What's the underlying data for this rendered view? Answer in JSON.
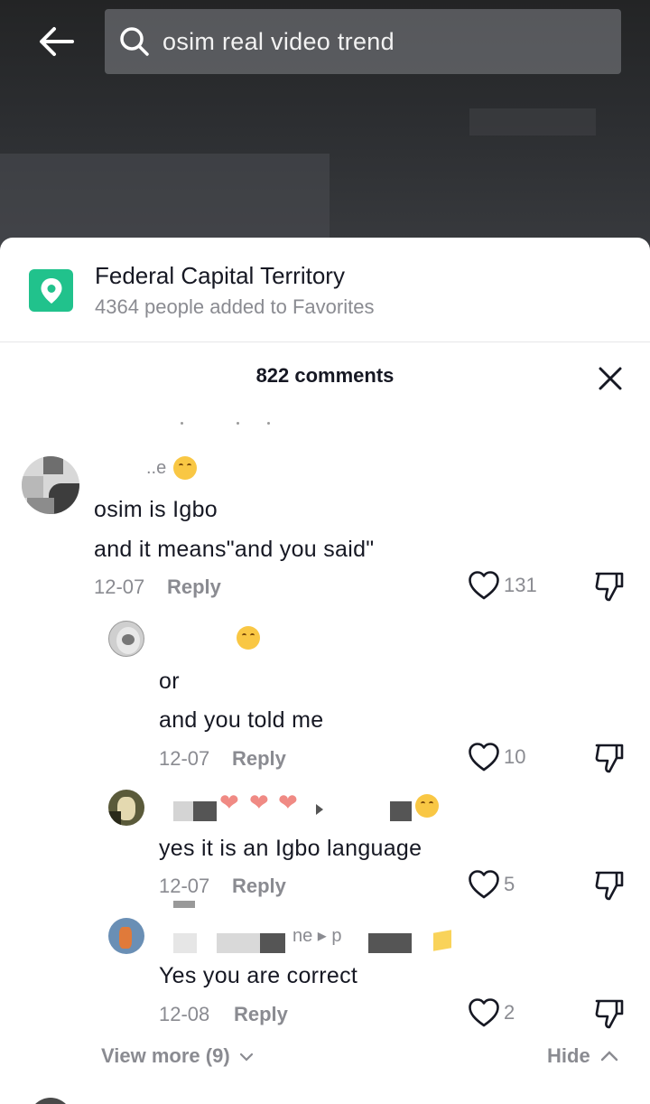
{
  "search": {
    "query": "osim real video trend"
  },
  "location": {
    "title": "Federal Capital Territory",
    "subtitle": "4364 people added to Favorites",
    "icon": "location-pin-icon",
    "color": "#21c28c"
  },
  "comments": {
    "count_label": "822 comments",
    "items": [
      {
        "name": "..e",
        "lines": [
          "osim is Igbo",
          "and it means\"and you said\""
        ],
        "date": "12-07",
        "reply_label": "Reply",
        "likes": "131"
      }
    ],
    "replies": [
      {
        "lines": [
          "or",
          "and you told me"
        ],
        "date": "12-07",
        "reply_label": "Reply",
        "likes": "10"
      },
      {
        "lines": [
          "yes it is an Igbo language"
        ],
        "date": "12-07",
        "reply_label": "Reply",
        "likes": "5"
      },
      {
        "name_fragment": "ne ▸ p",
        "lines": [
          "Yes you are correct"
        ],
        "date": "12-08",
        "reply_label": "Reply",
        "likes": "2"
      }
    ],
    "view_more_label": "View more (9)",
    "hide_label": "Hide"
  },
  "colors": {
    "accent": "#21c28c",
    "muted": "#8a8b91",
    "text": "#161823"
  }
}
